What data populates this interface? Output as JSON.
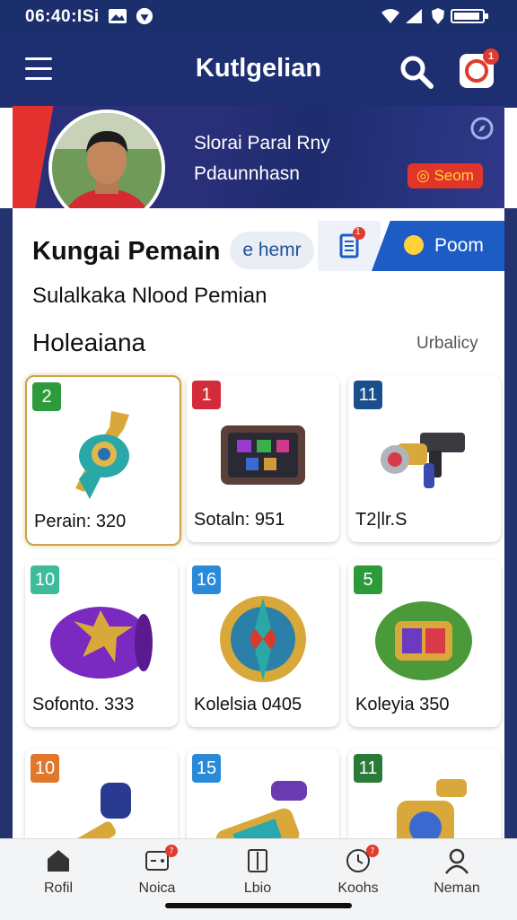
{
  "status": {
    "time": "06:40:ISi"
  },
  "app": {
    "title": "Kutlgelian"
  },
  "profile": {
    "name": "Slorai Paral Rny",
    "subtitle": "Pdaunnhasn",
    "badge": "Seom"
  },
  "header": {
    "title": "Kungai Pemain",
    "chip": "e hemr",
    "tab_badge": "1",
    "tab_active": "Poom"
  },
  "subtitle": "Sulalkaka Nlood Pemian",
  "section": {
    "title": "Holeaiana",
    "sort": "Urbalicy"
  },
  "items": [
    {
      "num": "2",
      "label": "Perain: 320",
      "color": "#2e9a3e",
      "icon": "gold-teal-scepter",
      "selected": true
    },
    {
      "num": "1",
      "label": "Sotaln: 951",
      "color": "#d42b3a",
      "icon": "gem-chest",
      "selected": false
    },
    {
      "num": "11",
      "label": "T2|lr.S",
      "color": "#1b4f8c",
      "icon": "ray-gun",
      "selected": false
    },
    {
      "num": "10",
      "label": "Sofonto. 333",
      "color": "#3dbb9a",
      "icon": "purple-bracer",
      "selected": false
    },
    {
      "num": "16",
      "label": "Kolelsia 0405",
      "color": "#2a8ad8",
      "icon": "gold-amulet",
      "selected": false
    },
    {
      "num": "5",
      "label": "Koleyia 350",
      "color": "#2d9a3a",
      "icon": "green-gauntlet",
      "selected": false
    },
    {
      "num": "10",
      "label": "",
      "color": "#e0772c",
      "icon": "blue-hammer",
      "selected": false
    },
    {
      "num": "15",
      "label": "",
      "color": "#2a8ad8",
      "icon": "gold-blaster",
      "selected": false
    },
    {
      "num": "11",
      "label": "",
      "color": "#2a7a3a",
      "icon": "gold-relic",
      "selected": false
    }
  ],
  "nav": [
    {
      "label": "Rofil",
      "icon": "home-icon",
      "badge": ""
    },
    {
      "label": "Noica",
      "icon": "gamepad-icon",
      "badge": "7"
    },
    {
      "label": "Lbio",
      "icon": "book-icon",
      "badge": ""
    },
    {
      "label": "Koohs",
      "icon": "clock-icon",
      "badge": "7"
    },
    {
      "label": "Neman",
      "icon": "user-icon",
      "badge": ""
    }
  ],
  "colors": {
    "appbar": "#1d2f70",
    "accent": "#1d5cc5",
    "badge": "#e23a2c"
  }
}
